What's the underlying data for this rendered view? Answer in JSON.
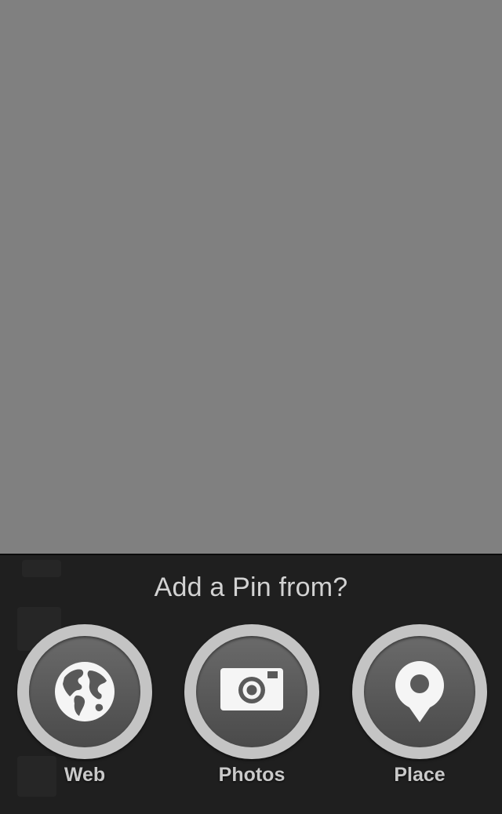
{
  "sheet": {
    "title": "Add a Pin from?",
    "options": [
      {
        "label": "Web",
        "icon": "globe-icon"
      },
      {
        "label": "Photos",
        "icon": "camera-icon"
      },
      {
        "label": "Place",
        "icon": "map-pin-icon"
      }
    ]
  },
  "colors": {
    "overlay": "#808080",
    "sheet_background": "#1f1f1f",
    "ring": "#c4c4c4",
    "disc": "#5a5a5a",
    "icon": "#f5f5f5",
    "label": "#c9c9c9"
  }
}
